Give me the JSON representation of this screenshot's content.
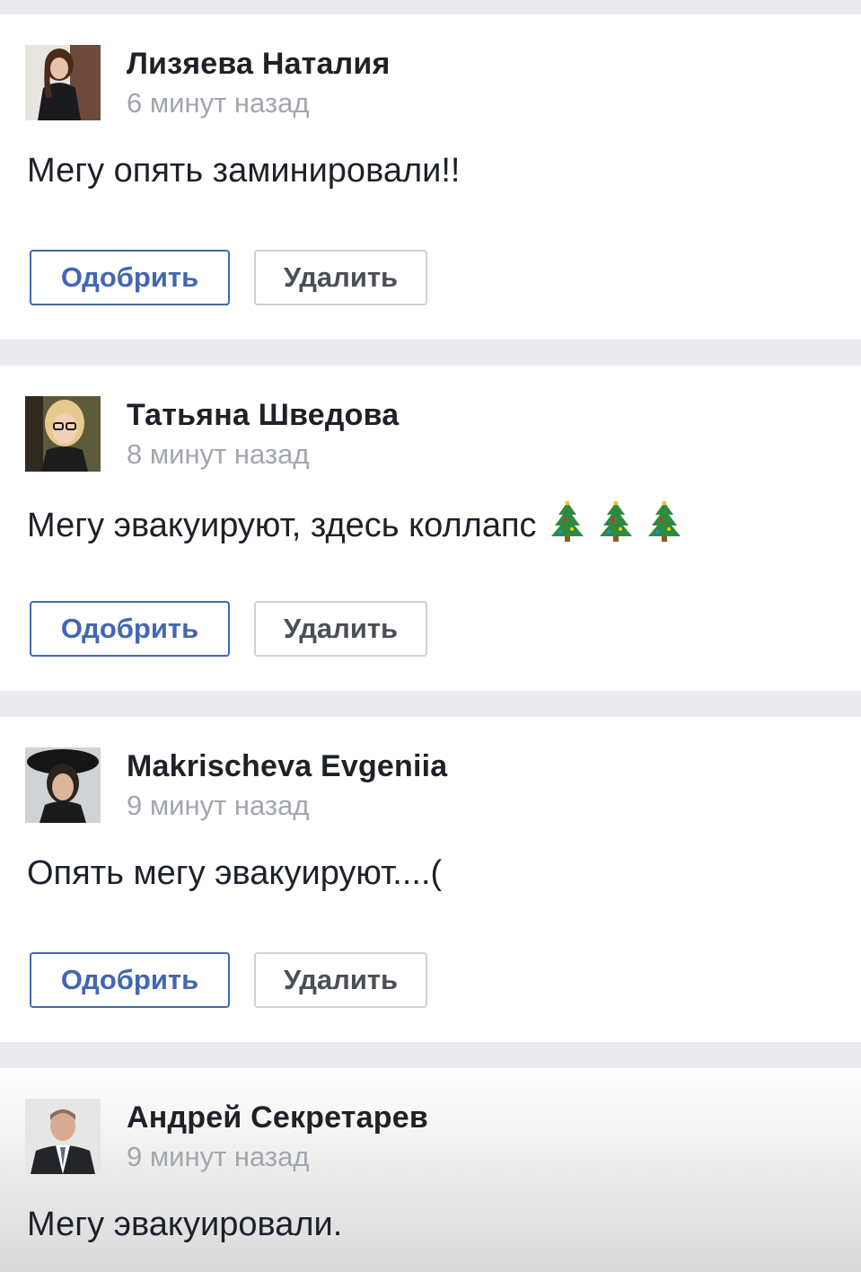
{
  "posts": [
    {
      "author": "Лизяева Наталия",
      "time": "6 минут назад",
      "text": "Мегу опять заминировали!!",
      "approve_label": "Одобрить",
      "delete_label": "Удалить"
    },
    {
      "author": "Татьяна Шведова",
      "time": "8 минут назад",
      "text": "Мегу эвакуируют, здесь коллапс",
      "emoji": [
        "christmas-tree",
        "christmas-tree",
        "christmas-tree"
      ],
      "approve_label": "Одобрить",
      "delete_label": "Удалить"
    },
    {
      "author": "Makrischeva Evgeniia",
      "time": "9 минут назад",
      "text": "Опять мегу эвакуируют....(",
      "approve_label": "Одобрить",
      "delete_label": "Удалить"
    },
    {
      "author": "Андрей Секретарев",
      "time": "9 минут назад",
      "text": "Мегу эвакуировали."
    }
  ],
  "colors": {
    "page_background": "#e9ebee",
    "approve_blue": "#4267b2",
    "name_text": "#1d2129",
    "time_text": "#a2a6ad"
  }
}
